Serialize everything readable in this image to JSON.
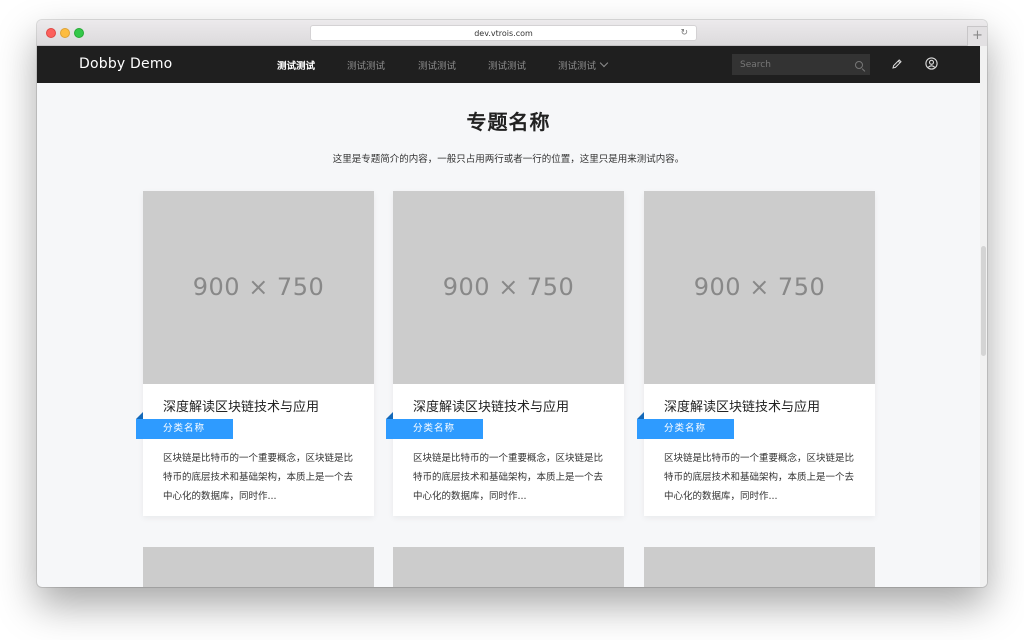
{
  "browser": {
    "url": "dev.vtrois.com"
  },
  "navbar": {
    "brand": "Dobby Demo",
    "items": [
      {
        "label": "测试测试",
        "active": true
      },
      {
        "label": "测试测试",
        "active": false
      },
      {
        "label": "测试测试",
        "active": false
      },
      {
        "label": "测试测试",
        "active": false
      },
      {
        "label": "测试测试",
        "active": false,
        "dropdown": true
      }
    ],
    "search_placeholder": "Search"
  },
  "page": {
    "title": "专题名称",
    "intro": "这里是专题简介的内容，一般只占用两行或者一行的位置，这里只是用来测试内容。"
  },
  "cards": [
    {
      "image_label": "900 × 750",
      "title": "深度解读区块链技术与应用",
      "category": "分类名称",
      "description": "区块链是比特币的一个重要概念，区块链是比特币的底层技术和基础架构，本质上是一个去中心化的数据库，同时作..."
    },
    {
      "image_label": "900 × 750",
      "title": "深度解读区块链技术与应用",
      "category": "分类名称",
      "description": "区块链是比特币的一个重要概念，区块链是比特币的底层技术和基础架构，本质上是一个去中心化的数据库，同时作..."
    },
    {
      "image_label": "900 × 750",
      "title": "深度解读区块链技术与应用",
      "category": "分类名称",
      "description": "区块链是比特币的一个重要概念，区块链是比特币的底层技术和基础架构，本质上是一个去中心化的数据库，同时作..."
    }
  ],
  "colors": {
    "navbar_bg": "#1f1f1f",
    "category_badge": "#2e9bff",
    "placeholder_image": "#cccccc",
    "page_bg": "#f6f7f9"
  }
}
